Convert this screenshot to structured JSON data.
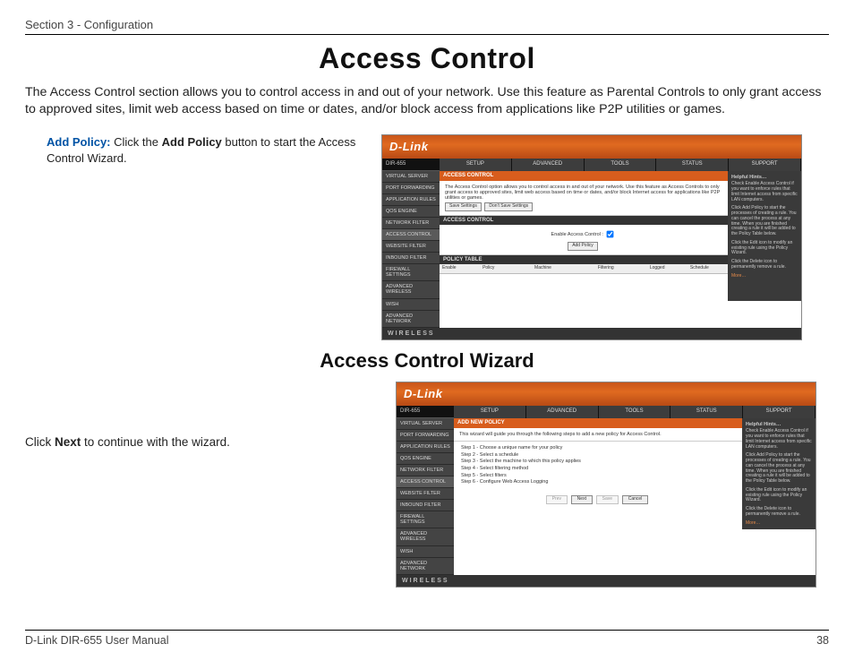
{
  "header": {
    "section": "Section 3 - Configuration"
  },
  "title": "Access Control",
  "intro": "The Access Control section allows you to control access in and out of your network. Use this feature as Parental Controls to only grant access to approved sites, limit web access based on time or dates, and/or block access from applications like P2P utilities or games.",
  "add_policy": {
    "label": "Add Policy:",
    "text_before": "Click the ",
    "bold": "Add Policy",
    "text_after": " button to start the Access Control Wizard."
  },
  "subtitle": "Access Control Wizard",
  "wizard_instruction": {
    "before": "Click ",
    "bold": "Next",
    "after": " to continue with the wizard."
  },
  "footer": {
    "left": "D-Link DIR-655 User Manual",
    "page": "38"
  },
  "ss_common": {
    "logo": "D-Link",
    "model": "DIR-655",
    "tabs": [
      "SETUP",
      "ADVANCED",
      "TOOLS",
      "STATUS",
      "SUPPORT"
    ],
    "nav": [
      "VIRTUAL SERVER",
      "PORT FORWARDING",
      "APPLICATION RULES",
      "QOS ENGINE",
      "NETWORK FILTER",
      "ACCESS CONTROL",
      "WEBSITE FILTER",
      "INBOUND FILTER",
      "FIREWALL SETTINGS",
      "ADVANCED WIRELESS",
      "WISH",
      "ADVANCED NETWORK"
    ],
    "footer": "WIRELESS",
    "hints_title": "Helpful Hints…",
    "hints": [
      "Check Enable Access Control if you want to enforce rules that limit Internet access from specific LAN computers.",
      "Click Add Policy to start the processes of creating a rule. You can cancel the process at any time. When you are finished creating a rule it will be added to the Policy Table below.",
      "Click the Edit icon to modify an existing rule using the Policy Wizard.",
      "Click the Delete icon to permanently remove a rule."
    ],
    "more": "More…"
  },
  "ss1": {
    "panel_title": "ACCESS CONTROL",
    "desc": "The Access Control option allows you to control access in and out of your network. Use this feature as Access Controls to only grant access to approved sites, limit web access based on time or dates, and/or block Internet access for applications like P2P utilities or games.",
    "save": "Save Settings",
    "dont_save": "Don't Save Settings",
    "section2": "ACCESS CONTROL",
    "enable_label": "Enable Access Control :",
    "add_policy_btn": "Add Policy",
    "policy_table": "POLICY TABLE",
    "cols": [
      "Enable",
      "Policy",
      "Machine",
      "Filtering",
      "Logged",
      "Schedule"
    ]
  },
  "ss2": {
    "panel_title": "ADD NEW POLICY",
    "desc": "This wizard will guide you through the following steps to add a new policy for Access Control.",
    "steps": [
      "Step 1 - Choose a unique name for your policy",
      "Step 2 - Select a schedule",
      "Step 3 - Select the machine to which this policy applies",
      "Step 4 - Select filtering method",
      "Step 5 - Select filters",
      "Step 6 - Configure Web Access Logging"
    ],
    "btns": [
      "Prev",
      "Next",
      "Save",
      "Cancel"
    ]
  }
}
